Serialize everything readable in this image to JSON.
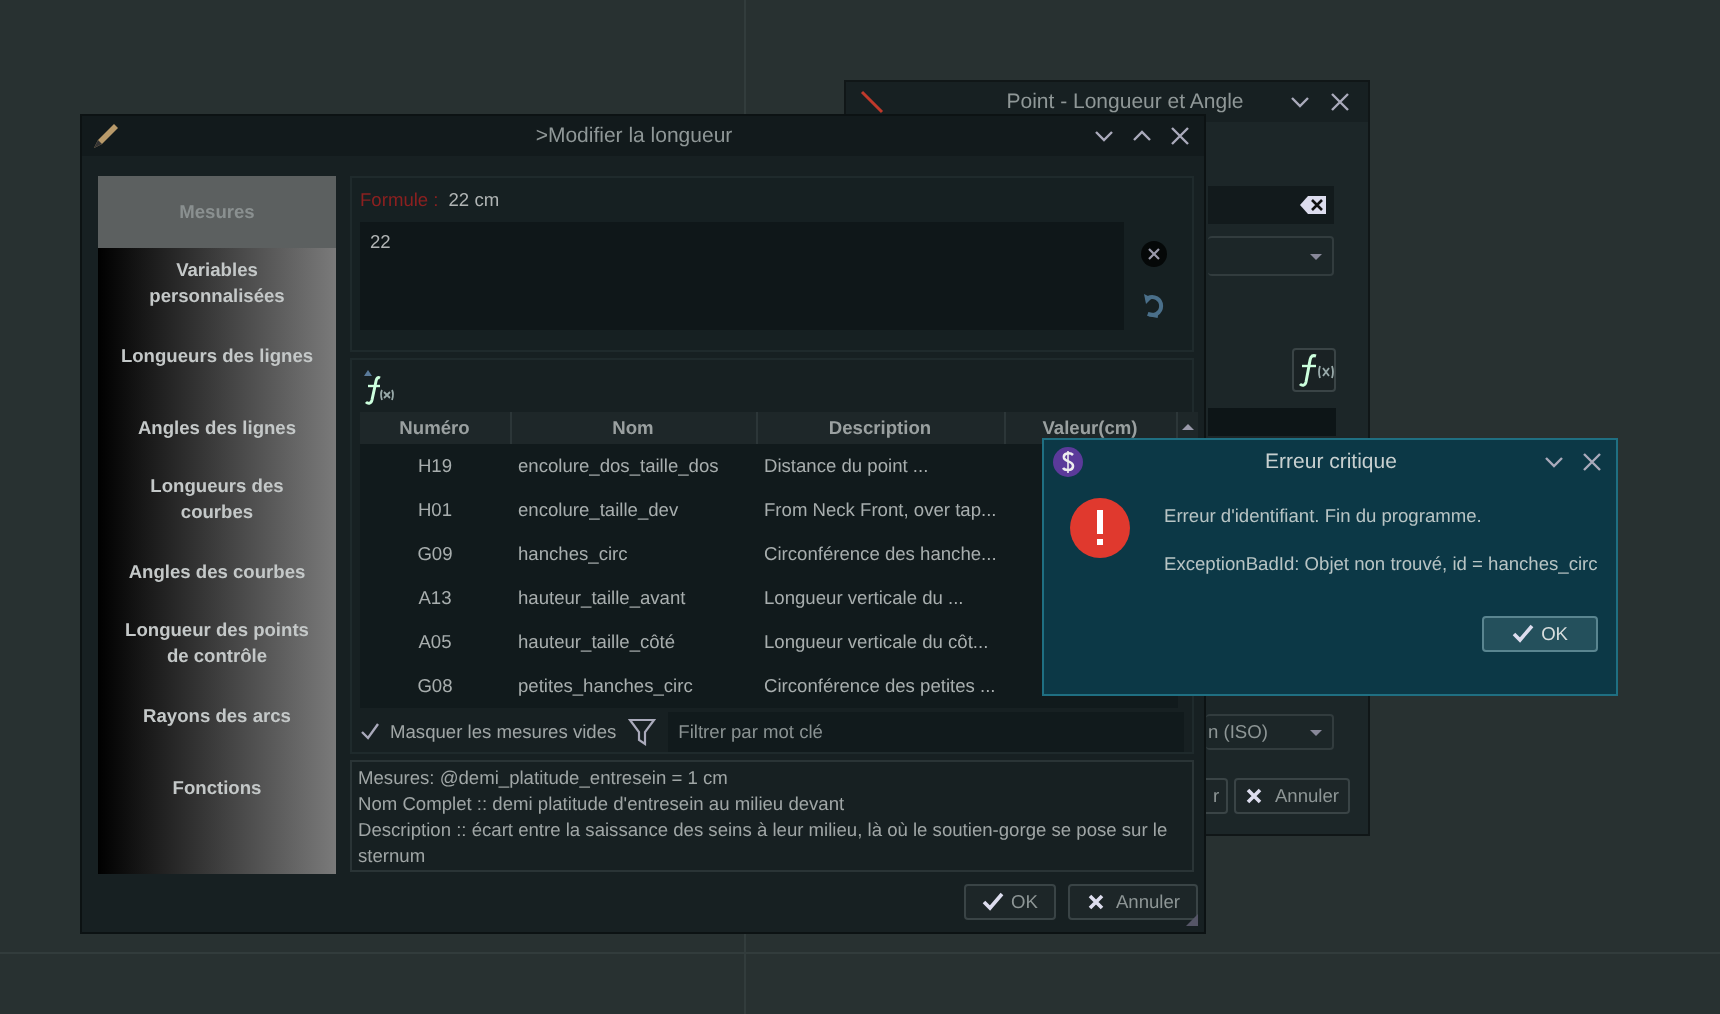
{
  "back_window": {
    "title": "Point - Longueur et Angle",
    "combo_text": "n (ISO)",
    "buttons": [
      {
        "label": "r"
      },
      {
        "label": "Annuler",
        "kind": "cancel"
      }
    ]
  },
  "main_window": {
    "title": ">Modifier la longueur",
    "sidebar": {
      "items": [
        {
          "label": "Mesures",
          "selected": true
        },
        {
          "label": "Variables personnalisées",
          "selected": false
        },
        {
          "label": "Longueurs des lignes",
          "selected": false
        },
        {
          "label": "Angles des lignes",
          "selected": false
        },
        {
          "label": "Longueurs des courbes",
          "selected": false
        },
        {
          "label": "Angles des courbes",
          "selected": false
        },
        {
          "label": "Longueur des points de contrôle",
          "selected": false
        },
        {
          "label": "Rayons des arcs",
          "selected": false
        },
        {
          "label": "Fonctions",
          "selected": false
        }
      ]
    },
    "formula": {
      "label": "Formule :",
      "result": "22 cm",
      "value": "22"
    },
    "table": {
      "columns": [
        "Numéro",
        "Nom",
        "Description",
        "Valeur(cm)"
      ],
      "rows": [
        {
          "number": "H19",
          "name": "encolure_dos_taille_dos",
          "description": "Distance du point ..."
        },
        {
          "number": "H01",
          "name": "encolure_taille_dev",
          "description": "From Neck Front, over tap..."
        },
        {
          "number": "G09",
          "name": "hanches_circ",
          "description": "Circonférence des hanche..."
        },
        {
          "number": "A13",
          "name": "hauteur_taille_avant",
          "description": "Longueur verticale du ..."
        },
        {
          "number": "A05",
          "name": "hauteur_taille_côté",
          "description": "Longueur verticale du côt..."
        },
        {
          "number": "G08",
          "name": "petites_hanches_circ",
          "description": "Circonférence des petites ..."
        }
      ]
    },
    "hide_empty": {
      "label": "Masquer les mesures vides",
      "checked": true
    },
    "filter": {
      "placeholder": "Filtrer par mot clé"
    },
    "info_lines": [
      "Mesures: @demi_platitude_entresein = 1 cm",
      "Nom Complet :: demi platitude d'entresein au milieu devant",
      "Description :: écart entre la saissance des seins à leur milieu, là où le soutien-gorge se pose sur le sternum"
    ],
    "buttons": [
      {
        "label": "OK",
        "kind": "ok"
      },
      {
        "label": "Annuler",
        "kind": "cancel"
      }
    ]
  },
  "error_dialog": {
    "title": "Erreur critique",
    "message": "Erreur d'identifiant. Fin du programme.",
    "detail": "ExceptionBadId: Objet non trouvé, id = hanches_circ",
    "button": {
      "label": "OK",
      "kind": "ok"
    }
  }
}
